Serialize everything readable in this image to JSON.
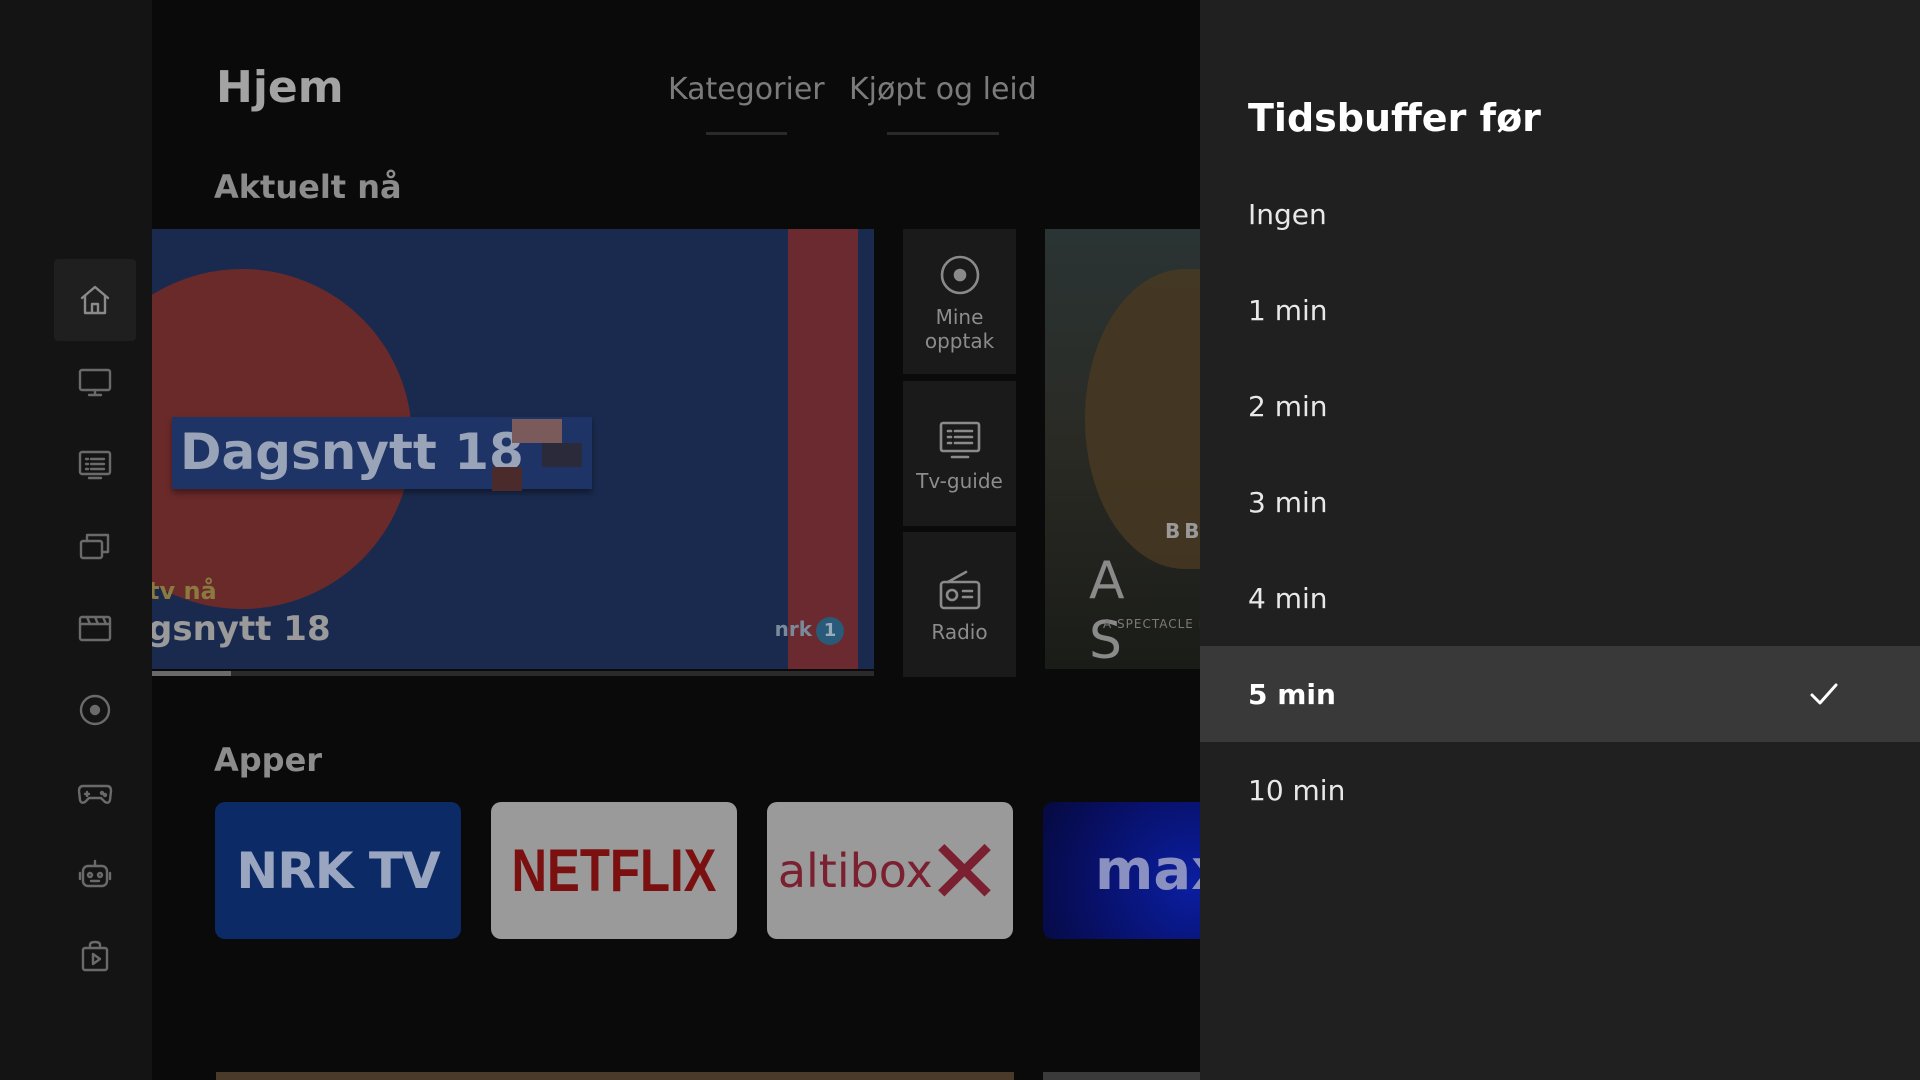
{
  "colors": {
    "background": "#0c0c0c",
    "rail": "#141414",
    "panel": "#202020",
    "selected_row": "#393939",
    "text_primary": "#ffffff"
  },
  "rail": {
    "items": [
      {
        "icon": "home-icon",
        "active": true
      },
      {
        "icon": "tv-icon",
        "active": false
      },
      {
        "icon": "tv-guide-icon",
        "active": false
      },
      {
        "icon": "library-icon",
        "active": false
      },
      {
        "icon": "movies-icon",
        "active": false
      },
      {
        "icon": "recordings-icon",
        "active": false
      },
      {
        "icon": "gamepad-icon",
        "active": false
      },
      {
        "icon": "kids-icon",
        "active": false
      },
      {
        "icon": "store-icon",
        "active": false
      }
    ]
  },
  "home": {
    "title": "Hjem",
    "tabs": [
      "Kategorier",
      "Kjøpt og leid"
    ],
    "current_section": "Aktuelt nå",
    "apps_section": "Apper",
    "hero": {
      "banner_text": "Dagsnytt 18",
      "live_label": "tv nå",
      "program_title": "gsnytt 18",
      "channel_logo": "nrk",
      "channel_number": "1",
      "progress": 0.11
    },
    "shortcuts": [
      {
        "label": "Mine opptak",
        "icon": "recordings-icon"
      },
      {
        "label": "Tv-guide",
        "icon": "tv-guide-icon"
      },
      {
        "label": "Radio",
        "icon": "radio-icon"
      }
    ],
    "promo": {
      "network": "BB",
      "title": "A S",
      "subtitle": "A SPECTACLE L"
    },
    "apps": [
      {
        "name": "NRK TV",
        "logo_text": "NRK TV"
      },
      {
        "name": "Netflix",
        "logo_text": "NETFLIX"
      },
      {
        "name": "Altibox",
        "logo_text": "altibox"
      },
      {
        "name": "Max",
        "logo_text": "max"
      }
    ]
  },
  "panel": {
    "title": "Tidsbuffer før",
    "options": [
      {
        "label": "Ingen",
        "selected": false
      },
      {
        "label": "1 min",
        "selected": false
      },
      {
        "label": "2 min",
        "selected": false
      },
      {
        "label": "3 min",
        "selected": false
      },
      {
        "label": "4 min",
        "selected": false
      },
      {
        "label": "5 min",
        "selected": true
      },
      {
        "label": "10 min",
        "selected": false
      }
    ]
  }
}
